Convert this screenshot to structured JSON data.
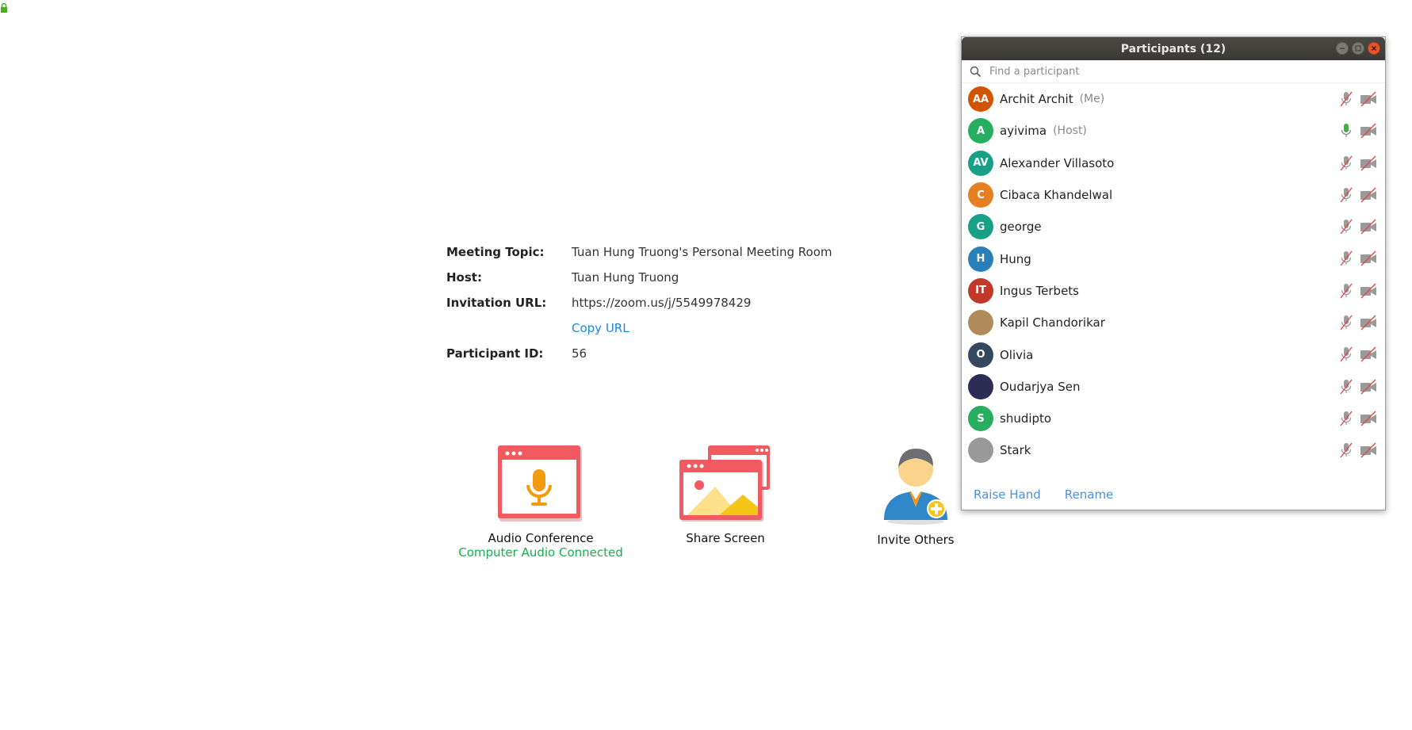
{
  "meeting": {
    "topic_label": "Meeting Topic:",
    "topic": "Tuan Hung Truong's Personal Meeting Room",
    "host_label": "Host:",
    "host": "Tuan Hung Truong",
    "url_label": "Invitation URL:",
    "url": "https://zoom.us/j/5549978429",
    "copy_url": "Copy URL",
    "pid_label": "Participant ID:",
    "pid": "56"
  },
  "actions": {
    "audio_label": "Audio Conference",
    "audio_status": "Computer Audio Connected",
    "share_label": "Share Screen",
    "invite_label": "Invite Others"
  },
  "participants_window": {
    "title": "Participants (12)",
    "search_placeholder": "Find a participant",
    "raise_hand": "Raise Hand",
    "rename": "Rename"
  },
  "participants": [
    {
      "initials": "AA",
      "name": "Archit Archit",
      "tag": "(Me)",
      "color": "#d35400",
      "mic": "muted"
    },
    {
      "initials": "A",
      "name": "ayivima",
      "tag": "(Host)",
      "color": "#27ae60",
      "mic": "on"
    },
    {
      "initials": "AV",
      "name": "Alexander Villasoto",
      "tag": "",
      "color": "#16a085",
      "mic": "muted"
    },
    {
      "initials": "C",
      "name": "Cibaca Khandelwal",
      "tag": "",
      "color": "#e67e22",
      "mic": "muted"
    },
    {
      "initials": "G",
      "name": "george",
      "tag": "",
      "color": "#16a085",
      "mic": "muted"
    },
    {
      "initials": "H",
      "name": "Hung",
      "tag": "",
      "color": "#2980b9",
      "mic": "muted"
    },
    {
      "initials": "IT",
      "name": "Ingus Terbets",
      "tag": "",
      "color": "#c0392b",
      "mic": "muted"
    },
    {
      "initials": "",
      "name": "Kapil Chandorikar",
      "tag": "",
      "color": "#b08a5a",
      "mic": "muted"
    },
    {
      "initials": "O",
      "name": "Olivia",
      "tag": "",
      "color": "#34495e",
      "mic": "muted"
    },
    {
      "initials": "",
      "name": "Oudarjya Sen",
      "tag": "",
      "color": "#2c2c54",
      "mic": "muted"
    },
    {
      "initials": "S",
      "name": "shudipto",
      "tag": "",
      "color": "#27ae60",
      "mic": "muted"
    },
    {
      "initials": "",
      "name": "Stark",
      "tag": "",
      "color": "#999999",
      "mic": "muted"
    }
  ]
}
